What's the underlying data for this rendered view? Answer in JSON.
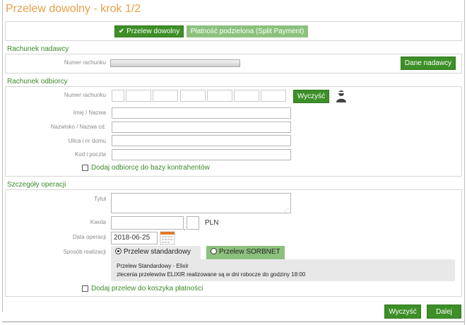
{
  "page_title": "Przelew dowolny - krok 1/2",
  "transfer_type": {
    "active_label": "Przelew dowolny",
    "split_label": "Płatność podzielona (Split Payment)"
  },
  "sender": {
    "section_title": "Rachunek nadawcy",
    "account_label": "Numer rachunku",
    "details_button": "Dane nadawcy"
  },
  "recipient": {
    "section_title": "Rachunek odbiorcy",
    "account_label": "Numer rachunku",
    "clear_button": "Wyczyść",
    "name_label": "Imię / Nazwa",
    "surname_label": "Nazwisko / Nazwa cd.",
    "street_label": "Ulica i nr domu",
    "postal_label": "Kod i poczta",
    "add_contractor_label": "Dodaj odbiorcę do bazy kontrahentów"
  },
  "operation": {
    "section_title": "Szczegóły operacji",
    "title_label": "Tytuł",
    "amount_label": "Kwota",
    "currency": "PLN",
    "date_label": "Data operacji",
    "date_value": "2018-06-25",
    "method_label": "Sposób realizacji",
    "standard_label": "Przelew standardowy",
    "sorbnet_label": "Przelew SORBNET",
    "info_line1": "Przelew Standardowy - Elixir",
    "info_line2": "zlecenia przelewów ELIXIR realizowane są w dni robocze do godziny 18:00",
    "add_basket_label": "Dodaj przelew do koszyka płatności"
  },
  "footer": {
    "clear_button": "Wyczyść",
    "next_button": "Dalej"
  }
}
